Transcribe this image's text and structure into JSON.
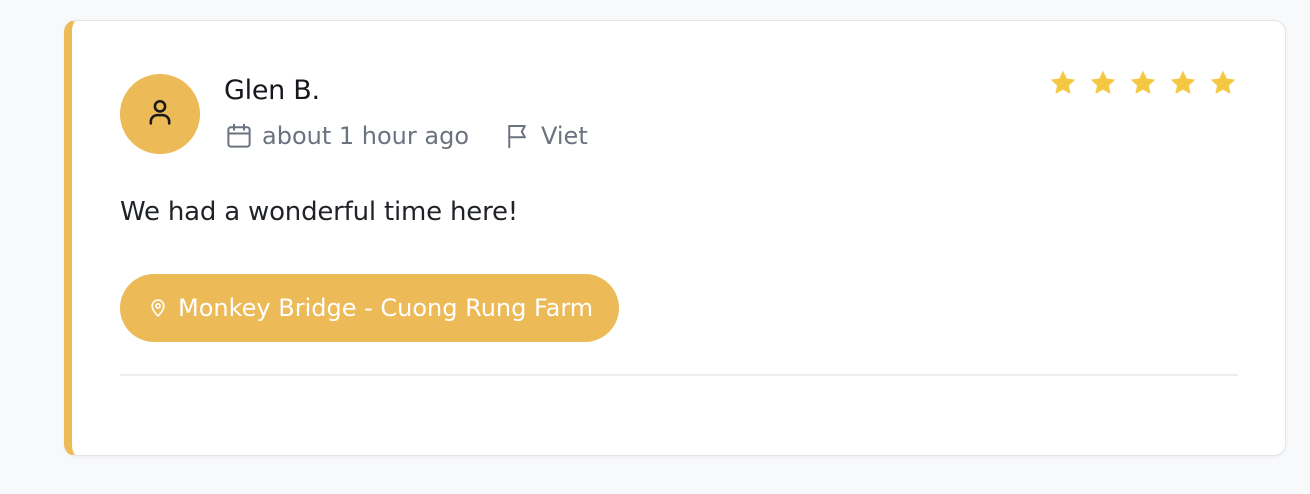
{
  "review": {
    "reviewer_name": "Glen B.",
    "time_ago": "about 1 hour ago",
    "language": "Viet",
    "rating": 5,
    "rating_max": 5,
    "text": "We had a wonderful time here!",
    "location_tag": "Monkey Bridge - Cuong Rung Farm"
  },
  "colors": {
    "accent": "#ecba56",
    "star": "#f5c842",
    "muted_text": "#6b7280",
    "body_text": "#1f2328"
  },
  "icons": {
    "avatar": "user-icon",
    "time": "calendar-icon",
    "language": "flag-icon",
    "location": "map-pin-icon",
    "rating": "star-icon"
  }
}
